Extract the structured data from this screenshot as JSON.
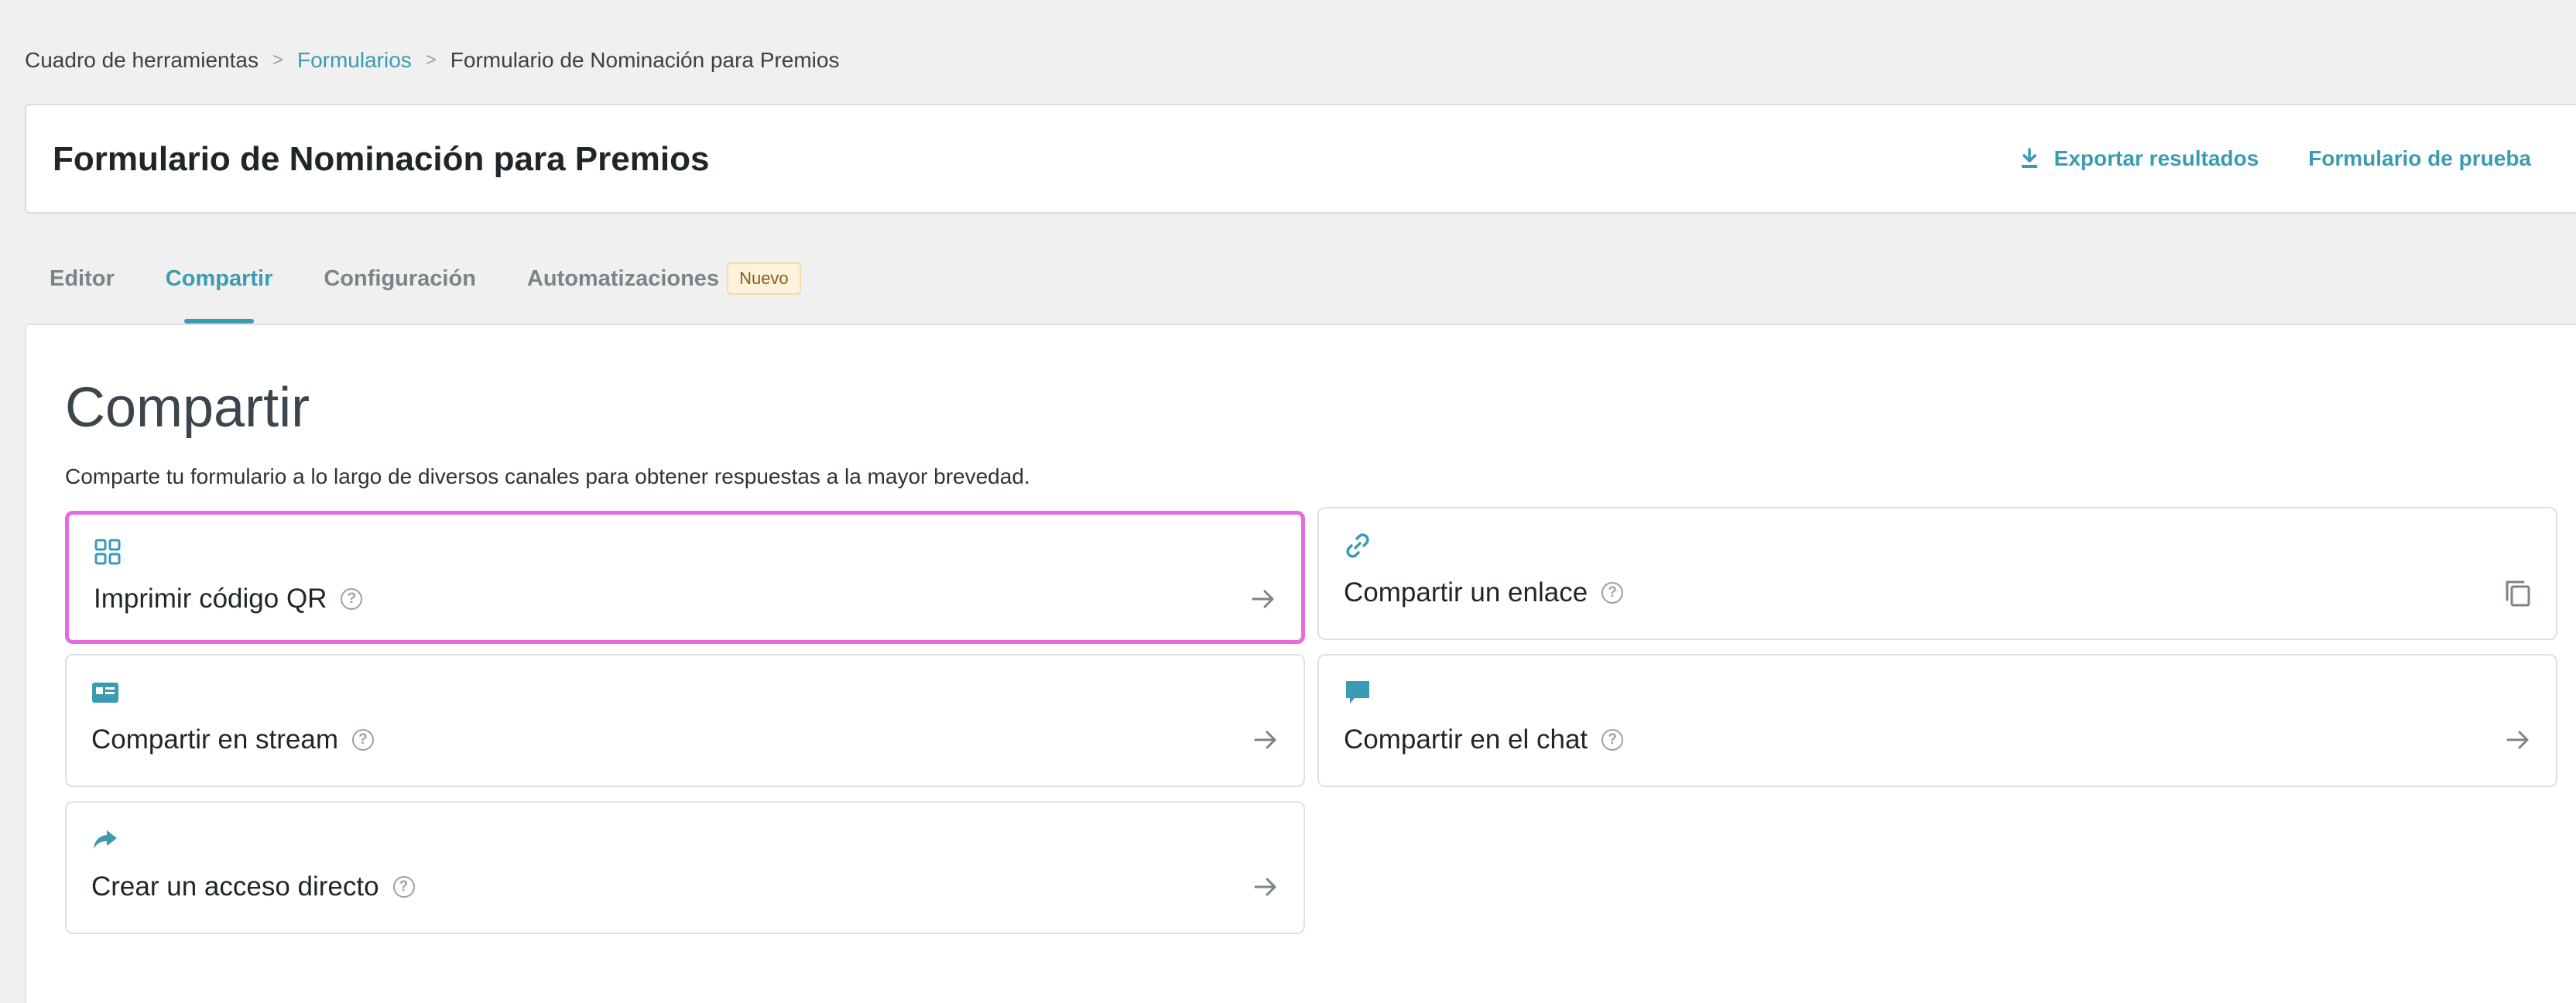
{
  "breadcrumb": {
    "items": [
      "Cuadro de herramientas",
      "Formularios",
      "Formulario de Nominación para Premios"
    ],
    "separator": ">"
  },
  "header": {
    "title": "Formulario de Nominación para Premios",
    "export_label": "Exportar resultados",
    "test_label": "Formulario de prueba"
  },
  "tabs": [
    {
      "label": "Editor"
    },
    {
      "label": "Compartir",
      "active": true
    },
    {
      "label": "Configuración"
    },
    {
      "label": "Automatizaciones",
      "badge": "Nuevo"
    }
  ],
  "main": {
    "heading": "Compartir",
    "description": "Comparte tu formulario a lo largo de diversos canales para obtener respuestas a la mayor brevedad."
  },
  "options": [
    {
      "label": "Imprimir código QR",
      "icon": "qr-grid-icon",
      "action_icon": "arrow-right-icon",
      "highlighted": true
    },
    {
      "label": "Compartir un enlace",
      "icon": "link-icon",
      "action_icon": "copy-icon"
    },
    {
      "label": "Compartir en stream",
      "icon": "stream-card-icon",
      "action_icon": "arrow-right-icon"
    },
    {
      "label": "Compartir en el chat",
      "icon": "chat-bubble-icon",
      "action_icon": "arrow-right-icon"
    },
    {
      "label": "Crear un acceso directo",
      "icon": "share-arrow-icon",
      "action_icon": "arrow-right-icon"
    }
  ],
  "colors": {
    "accent": "#3a9bb3",
    "highlight": "#e66ae0",
    "background": "#f0f0f0"
  }
}
